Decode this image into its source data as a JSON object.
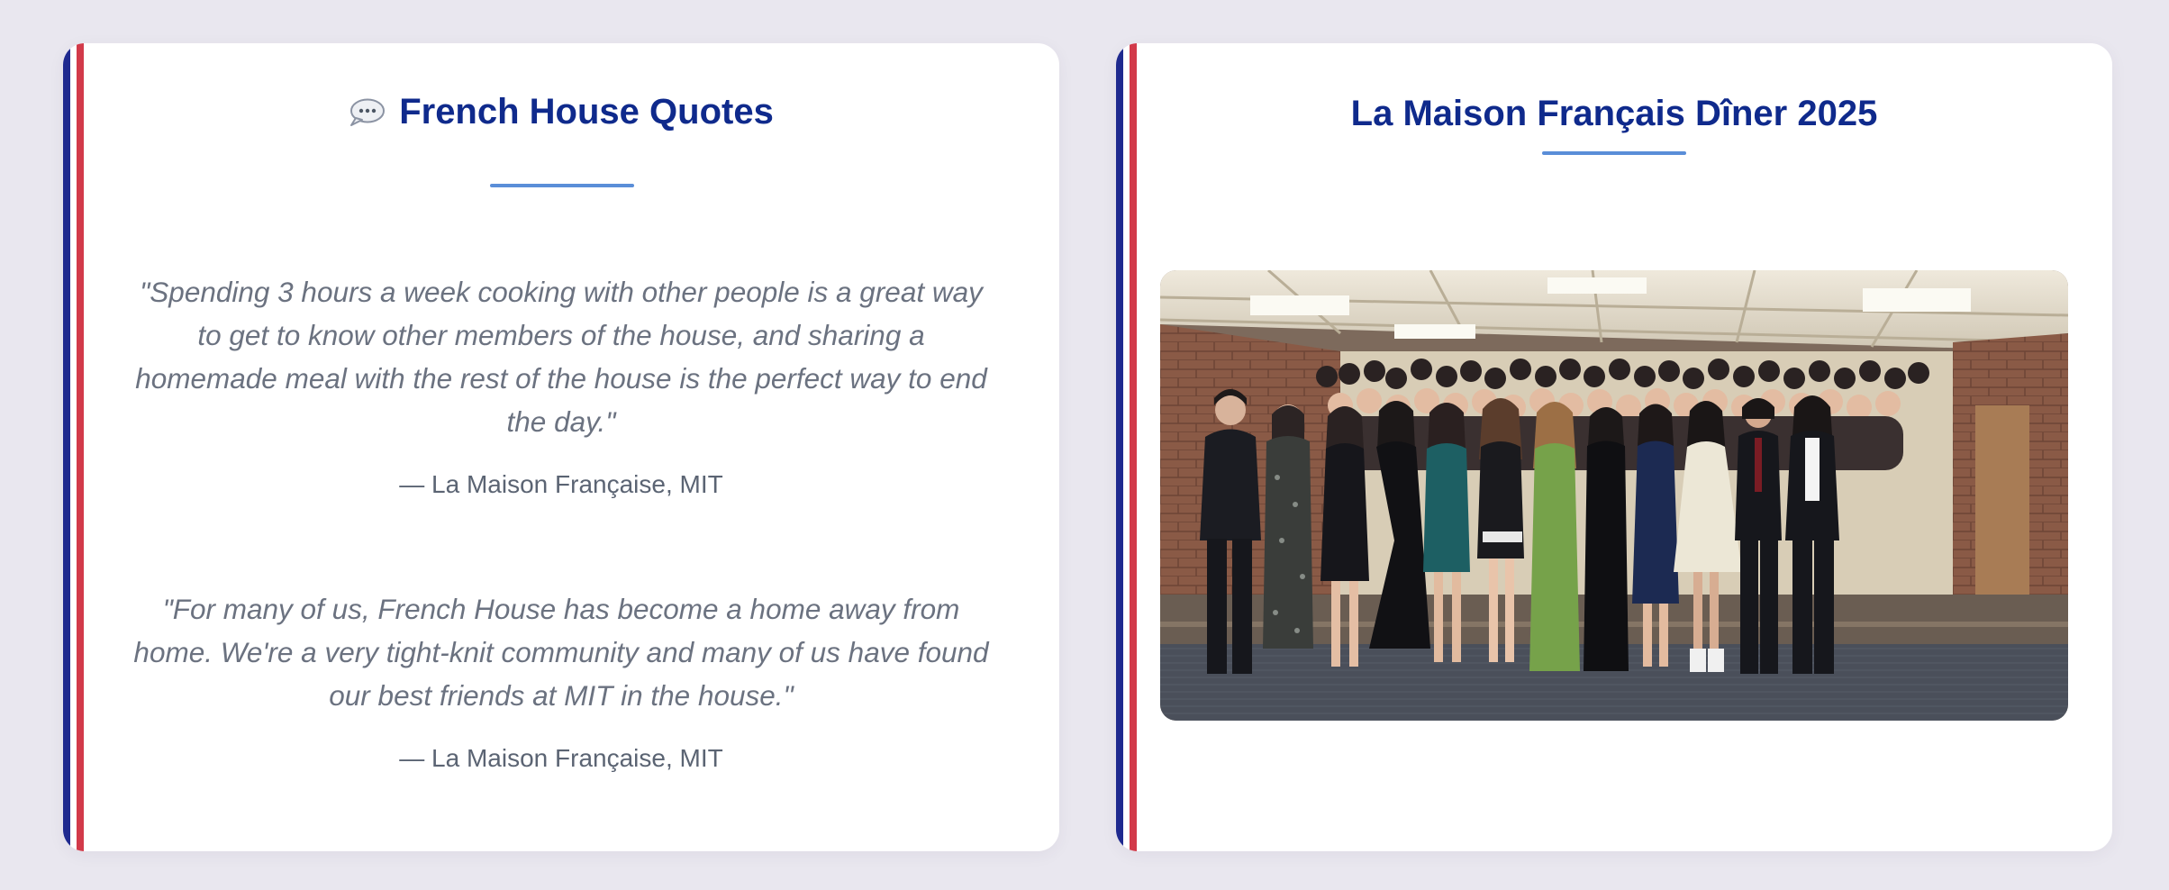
{
  "colors": {
    "background": "#e9e7ef",
    "card": "#ffffff",
    "flag_blue": "#1f2a8f",
    "flag_red": "#d23a4a",
    "title": "#0f2a8c",
    "underline": "#5a8ed8",
    "quote_text": "#6b7280",
    "attribution": "#5b6473"
  },
  "quotes_card": {
    "icon": "speech-bubble-icon",
    "title": "French House Quotes",
    "quotes": [
      {
        "text": "\"Spending 3 hours a week cooking with other people is a great way to get to know other members of the house, and sharing a homemade meal with the rest of the house is the perfect way to end the day.\"",
        "attribution": "— La Maison Française, MIT"
      },
      {
        "text": "\"For many of us, French House has become a home away from home. We're a very tight-knit community and many of us have found our best friends at MIT in the house.\"",
        "attribution": "— La Maison Française, MIT"
      }
    ]
  },
  "photo_card": {
    "title": "La Maison Français Dîner 2025"
  }
}
